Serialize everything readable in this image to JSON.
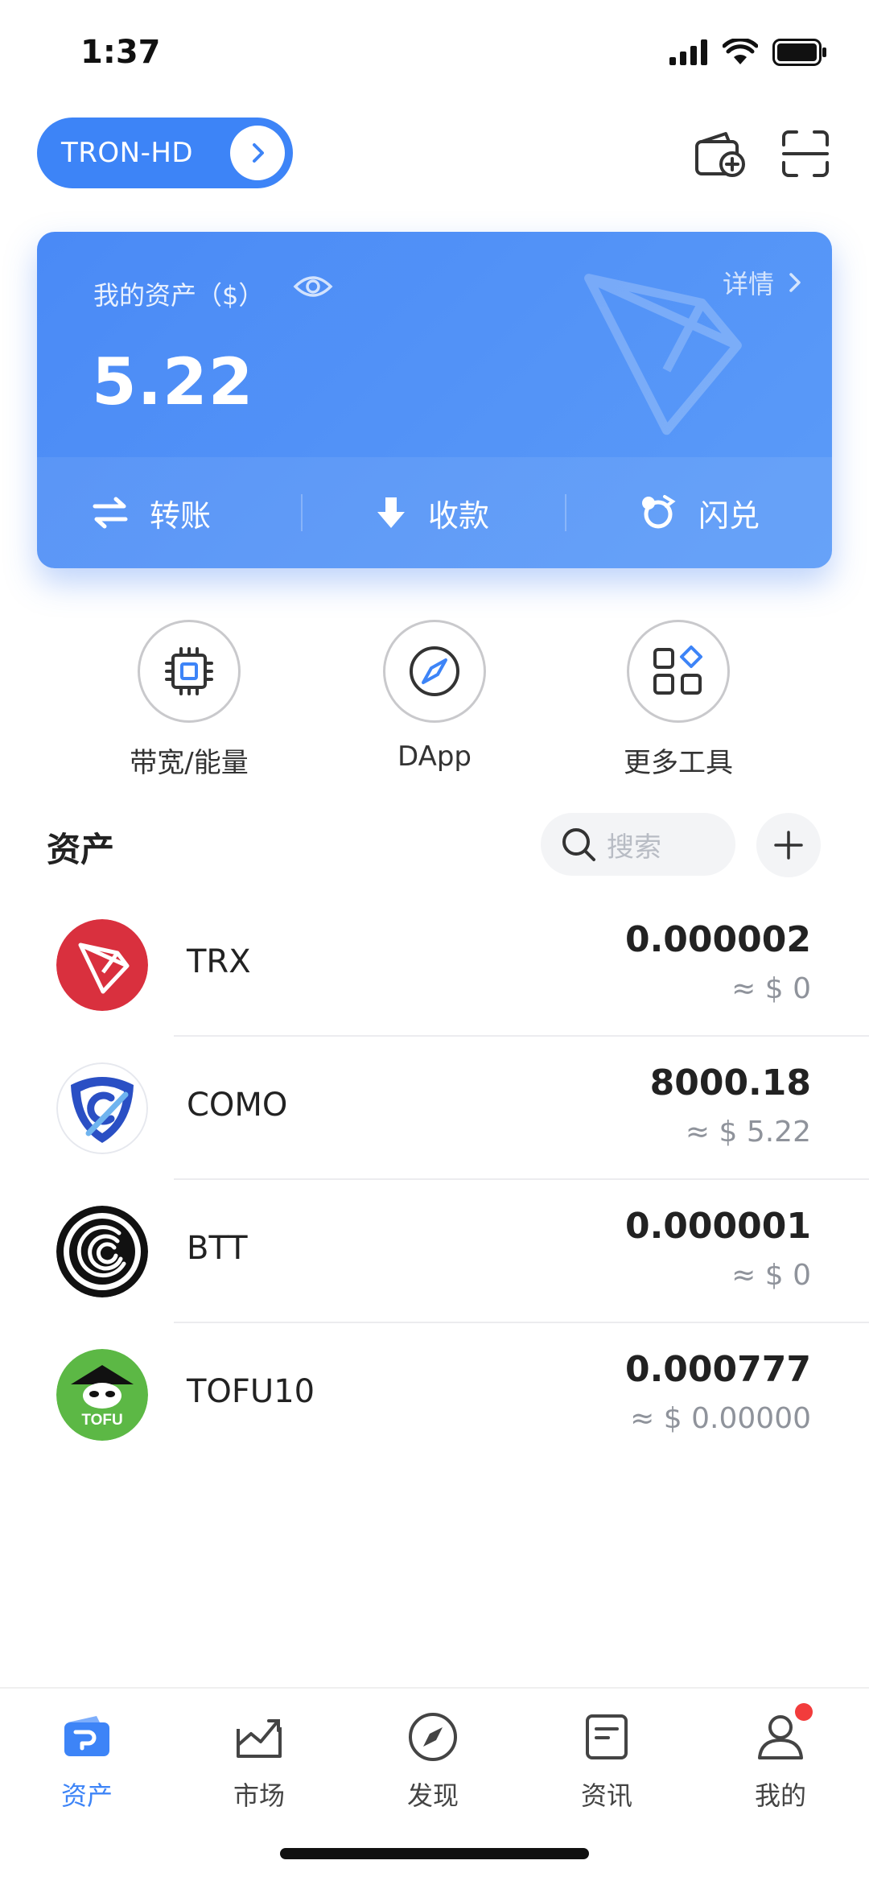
{
  "status_bar": {
    "time": "1:37"
  },
  "header": {
    "wallet_name": "TRON-HD"
  },
  "asset_card": {
    "label": "我的资产（$）",
    "detail_label": "详情",
    "total_amount": "5.22",
    "actions": [
      {
        "label": "转账",
        "icon": "transfer-icon"
      },
      {
        "label": "收款",
        "icon": "receive-icon"
      },
      {
        "label": "闪兑",
        "icon": "swap-icon"
      }
    ]
  },
  "tools": [
    {
      "label": "带宽/能量",
      "icon": "chip-icon"
    },
    {
      "label": "DApp",
      "icon": "compass-icon"
    },
    {
      "label": "更多工具",
      "icon": "grid-icon"
    }
  ],
  "assets_section": {
    "title": "资产",
    "search_placeholder": "搜索"
  },
  "tokens": [
    {
      "symbol": "TRX",
      "balance": "0.000002",
      "value": "≈ $ 0",
      "color": "#d9303e"
    },
    {
      "symbol": "COMO",
      "balance": "8000.18",
      "value": "≈ $ 5.22",
      "color": "#2a4fc4"
    },
    {
      "symbol": "BTT",
      "balance": "0.000001",
      "value": "≈ $ 0",
      "color": "#111111"
    },
    {
      "symbol": "TOFU10",
      "balance": "0.000777",
      "value": "≈ $ 0.00000",
      "color": "#5cb845",
      "logo_text": "TOFU"
    }
  ],
  "bottom_nav": [
    {
      "label": "资产",
      "icon": "wallet-icon",
      "active": true
    },
    {
      "label": "市场",
      "icon": "market-chart-icon",
      "active": false
    },
    {
      "label": "发现",
      "icon": "discover-compass-icon",
      "active": false
    },
    {
      "label": "资讯",
      "icon": "news-icon",
      "active": false
    },
    {
      "label": "我的",
      "icon": "profile-icon",
      "active": false
    }
  ],
  "colors": {
    "accent": "#3d84f7",
    "badge": "#f23c3c"
  }
}
